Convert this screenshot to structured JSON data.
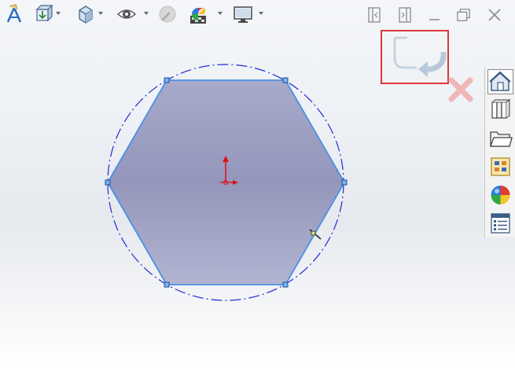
{
  "toolbar": {
    "icons": [
      "annotation-icon",
      "view-orientation-icon",
      "display-style-icon",
      "hide-show-items-icon",
      "edit-appearance-icon",
      "apply-scene-icon",
      "view-settings-icon"
    ]
  },
  "window_controls": [
    "tile-left-icon",
    "tile-right-icon",
    "minimize-icon",
    "restore-icon",
    "close-icon"
  ],
  "confirmation_corner": {
    "accept": "exit-sketch-icon",
    "cancel": "cancel-sketch-icon",
    "highlight_color": "#e0373a"
  },
  "task_pane": {
    "tabs": [
      "solidworks-resources-icon",
      "design-library-icon",
      "file-explorer-icon",
      "view-palette-icon",
      "appearances-scenes-icon",
      "custom-properties-icon"
    ],
    "active_tab": "solidworks-resources-icon"
  },
  "sketch": {
    "shape": "hexagon",
    "fill_color": "#9a9ec0",
    "edge_color": "#4a90e2",
    "construction_circle_color": "#1f2bd6",
    "vertex_count": 6
  }
}
